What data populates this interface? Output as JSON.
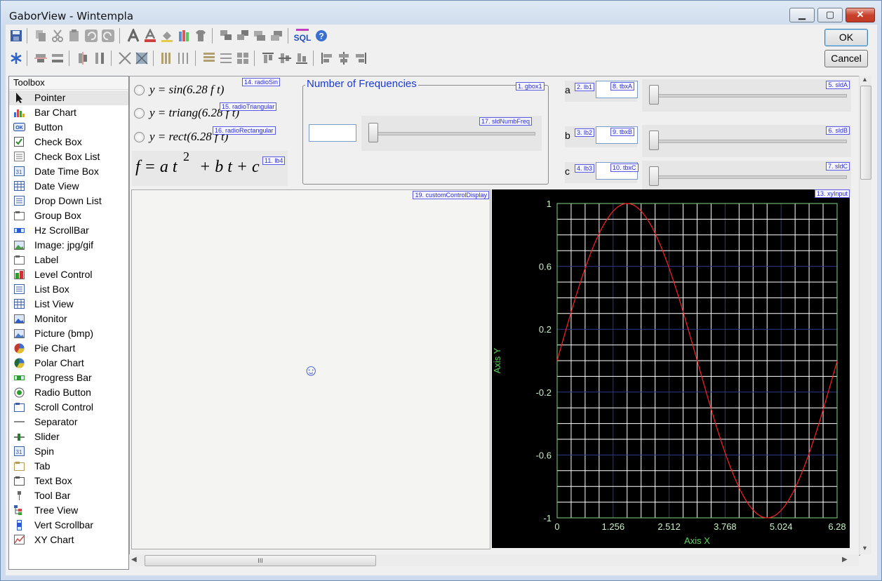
{
  "window": {
    "title": "GaborView   -   Wintempla",
    "ok": "OK",
    "cancel": "Cancel",
    "minimize": "▁",
    "maximize": "▢",
    "close": "✕"
  },
  "toolbox": {
    "title": "Toolbox",
    "items": [
      "Pointer",
      "Bar Chart",
      "Button",
      "Check Box",
      "Check Box List",
      "Date Time Box",
      "Date View",
      "Drop Down List",
      "Group Box",
      "Hz ScrollBar",
      "Image: jpg/gif",
      "Label",
      "Level Control",
      "List Box",
      "List View",
      "Monitor",
      "Picture (bmp)",
      "Pie Chart",
      "Polar Chart",
      "Progress Bar",
      "Radio Button",
      "Scroll Control",
      "Separator",
      "Slider",
      "Spin",
      "Tab",
      "Text Box",
      "Tool Bar",
      "Tree View",
      "Vert Scrollbar",
      "XY Chart"
    ]
  },
  "design": {
    "radios": [
      {
        "label": "y = sin(6.28 f t)",
        "tag": "14. radioSin"
      },
      {
        "label": "y = triang(6.28 f t)",
        "tag": "15. radioTriangular"
      },
      {
        "label": "y = rect(6.28 f t)",
        "tag": "16. radioRectangular"
      }
    ],
    "formula": {
      "base": "f = a t",
      "exp": "2",
      "rest": "+ b t + c",
      "tag": "11. lb4"
    },
    "gbox": {
      "title": "Number of Frequencies",
      "tag": "1. gbox1",
      "slider_tag": "17. sldNumbFreq",
      "slider_value": 0
    },
    "params": [
      {
        "label": "a",
        "lbtag": "2. lb1",
        "tbxtag": "8. tbxA",
        "sldtag": "5. sldA",
        "value": 0
      },
      {
        "label": "b",
        "lbtag": "3. lb2",
        "tbxtag": "9. tbxB",
        "sldtag": "6. sldB",
        "value": 0
      },
      {
        "label": "c",
        "lbtag": "4. lb3",
        "tbxtag": "10. tbxC",
        "sldtag": "7. sldC",
        "value": 0
      }
    ],
    "custom": {
      "tag": "19. customControlDisplay",
      "icon": "☺"
    },
    "scroll": {
      "thumb": "III",
      "up": "▲",
      "down": "▼",
      "left": "◀",
      "right": "▶"
    }
  },
  "colors": {
    "plot_bg": "#000000",
    "grid": "#ffffff",
    "axis_frame": "#7fd47f",
    "curve": "#ff2020",
    "tick_text": "#c8f0c8",
    "axis_label": "#60d060"
  },
  "chart_data": {
    "type": "line",
    "tag": "13. xyInput",
    "xlabel": "Axis X",
    "ylabel": "Axis Y",
    "xlim": [
      0,
      6.28
    ],
    "ylim": [
      -1,
      1
    ],
    "xticks": [
      0,
      1.256,
      2.512,
      3.768,
      5.024,
      6.28
    ],
    "yticks": [
      1,
      0.6,
      0.2,
      -0.2,
      -0.6,
      -1
    ],
    "xtick_labels": [
      "0",
      "1.256",
      "2.512",
      "3.768",
      "5.024",
      "6.28"
    ],
    "ytick_labels": [
      "1",
      "0.6",
      "0.2",
      "-0.2",
      "-0.6",
      "-1"
    ],
    "grid": true,
    "series": [
      {
        "function": "sin(x)",
        "x_range": [
          0,
          6.28
        ],
        "samples": 200
      }
    ]
  }
}
